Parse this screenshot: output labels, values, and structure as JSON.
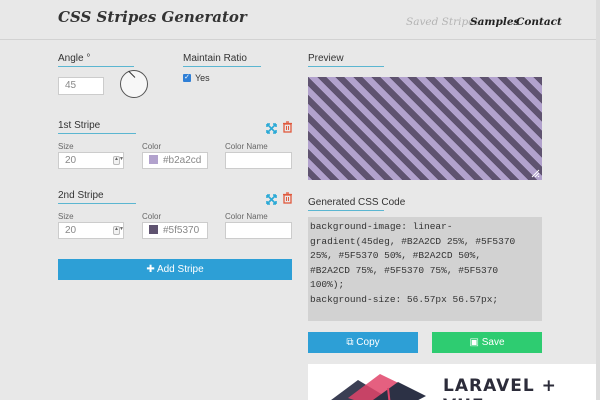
{
  "header": {
    "title": "CSS Stripes Generator",
    "nav": [
      "Saved Stripes",
      "Samples",
      "Contact"
    ]
  },
  "angle": {
    "label": "Angle °",
    "value": "45"
  },
  "ratio": {
    "label": "Maintain Ratio",
    "checked": true,
    "option": "Yes"
  },
  "stripes": [
    {
      "title": "1st Stripe",
      "size_label": "Size",
      "size": "20",
      "color_label": "Color",
      "color": "#b2a2cd",
      "name_label": "Color Name",
      "name": ""
    },
    {
      "title": "2nd Stripe",
      "size_label": "Size",
      "size": "20",
      "color_label": "Color",
      "color": "#5f5370",
      "name_label": "Color Name",
      "name": ""
    }
  ],
  "add_button": "Add Stripe",
  "preview": {
    "label": "Preview"
  },
  "code": {
    "label": "Generated CSS Code",
    "text": "background-image: linear-\ngradient(45deg, #B2A2CD 25%, #5F5370\n25%, #5F5370 50%, #B2A2CD 50%,\n#B2A2CD 75%, #5F5370 75%, #5F5370\n100%);\nbackground-size: 56.57px 56.57px;"
  },
  "actions": {
    "copy": "Copy",
    "save": "Save"
  },
  "ad": {
    "title": "LARAVEL + VUE"
  },
  "colors": {
    "accent": "#5bb6d1",
    "add": "#2d9fd6",
    "copy": "#2d9fd6",
    "save": "#2ecc71",
    "trash": "#e0593d",
    "expand": "#2aa9d6"
  },
  "icons": {
    "expand": "expand-icon",
    "trash": "trash-icon",
    "copy": "copy-icon",
    "save": "floppy-icon",
    "plus": "plus-icon"
  }
}
